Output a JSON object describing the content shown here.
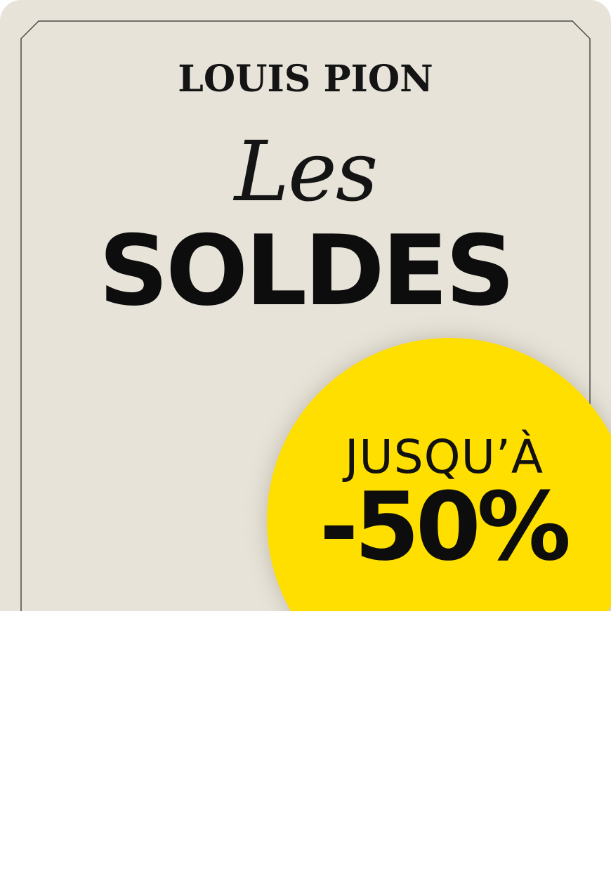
{
  "banner": {
    "brand": "LOUIS PION",
    "script_title": "Les",
    "main_title": "SOLDES",
    "promo": {
      "line1": "JUSQU’À",
      "line2": "-50%"
    }
  },
  "colors": {
    "background": "#e7e3d9",
    "frame_line": "#4a4a48",
    "text": "#111111",
    "promo_circle": "#ffdf00",
    "page": "#ffffff"
  }
}
